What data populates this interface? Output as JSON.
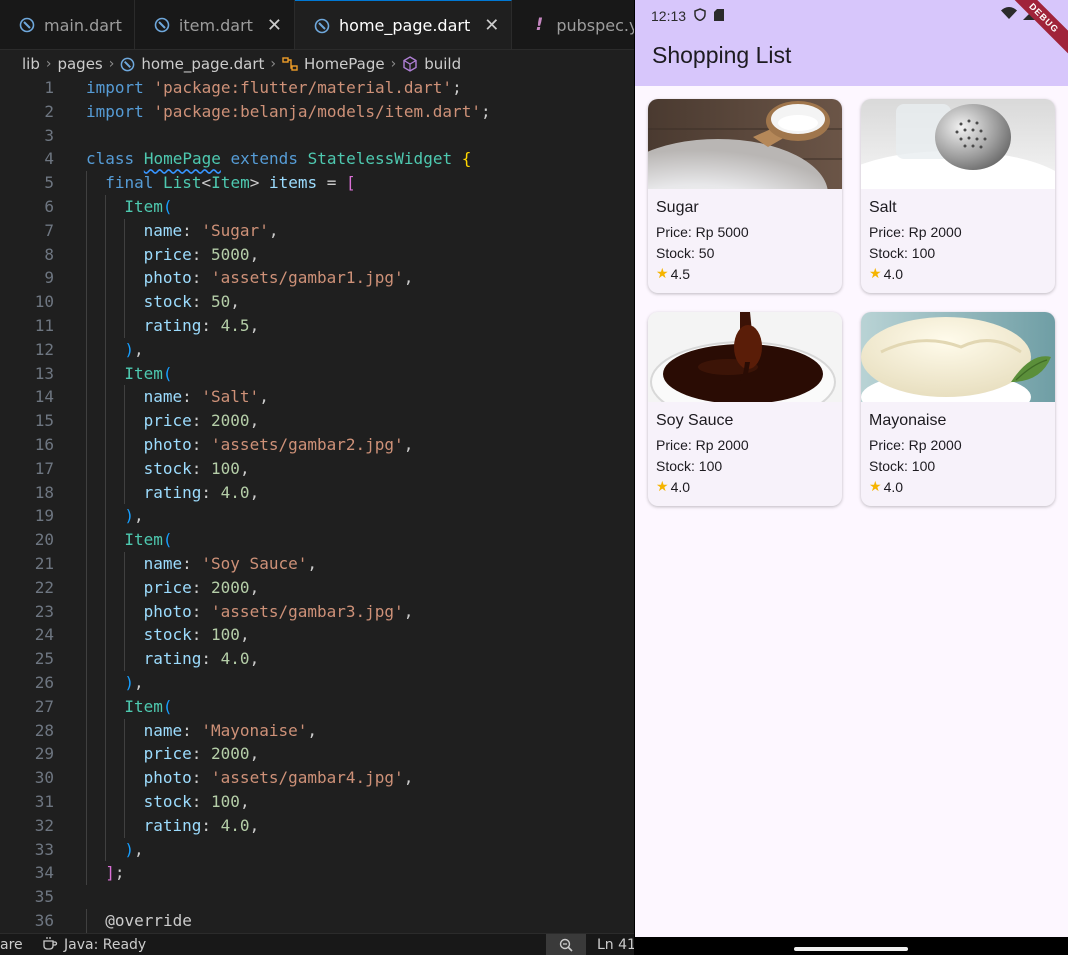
{
  "editor": {
    "tabs": [
      {
        "label": "main.dart",
        "icon": "dart-icon",
        "active": false,
        "closable": false
      },
      {
        "label": "item.dart",
        "icon": "dart-icon",
        "active": false,
        "closable": true
      },
      {
        "label": "home_page.dart",
        "icon": "dart-icon",
        "active": true,
        "closable": true
      },
      {
        "label": "pubspec.yaml",
        "icon": "warning-bang-icon",
        "active": false,
        "closable": false
      }
    ],
    "breadcrumb": [
      "lib",
      "pages",
      "home_page.dart",
      "HomePage",
      "build"
    ],
    "code_lines": [
      {
        "n": "1",
        "indent": 0,
        "tokens": [
          [
            "import",
            "kw"
          ],
          [
            " ",
            "plain"
          ],
          [
            "'package:flutter/material.dart'",
            "str"
          ],
          [
            ";",
            "plain"
          ]
        ]
      },
      {
        "n": "2",
        "indent": 0,
        "tokens": [
          [
            "import",
            "kw"
          ],
          [
            " ",
            "plain"
          ],
          [
            "'package:belanja/models/item.dart'",
            "str"
          ],
          [
            ";",
            "plain"
          ]
        ]
      },
      {
        "n": "3",
        "indent": 0,
        "tokens": []
      },
      {
        "n": "4",
        "indent": 0,
        "tokens": [
          [
            "class",
            "kw"
          ],
          [
            " ",
            "plain"
          ],
          [
            "HomePage",
            "cls squig"
          ],
          [
            " ",
            "plain"
          ],
          [
            "extends",
            "kw"
          ],
          [
            " ",
            "plain"
          ],
          [
            "StatelessWidget",
            "cls"
          ],
          [
            " ",
            "plain"
          ],
          [
            "{",
            "br1"
          ]
        ]
      },
      {
        "n": "5",
        "indent": 1,
        "tokens": [
          [
            "final",
            "kw"
          ],
          [
            " ",
            "plain"
          ],
          [
            "List",
            "cls"
          ],
          [
            "<",
            "plain"
          ],
          [
            "Item",
            "cls"
          ],
          [
            "> ",
            "plain"
          ],
          [
            "items",
            "prop"
          ],
          [
            " = ",
            "plain"
          ],
          [
            "[",
            "br2"
          ]
        ]
      },
      {
        "n": "6",
        "indent": 2,
        "tokens": [
          [
            "Item",
            "cls"
          ],
          [
            "(",
            "br3"
          ]
        ]
      },
      {
        "n": "7",
        "indent": 3,
        "tokens": [
          [
            "name",
            "prop"
          ],
          [
            ": ",
            "plain"
          ],
          [
            "'Sugar'",
            "str"
          ],
          [
            ",",
            "plain"
          ]
        ]
      },
      {
        "n": "8",
        "indent": 3,
        "tokens": [
          [
            "price",
            "prop"
          ],
          [
            ": ",
            "plain"
          ],
          [
            "5000",
            "num"
          ],
          [
            ",",
            "plain"
          ]
        ]
      },
      {
        "n": "9",
        "indent": 3,
        "tokens": [
          [
            "photo",
            "prop"
          ],
          [
            ": ",
            "plain"
          ],
          [
            "'assets/gambar1.jpg'",
            "str"
          ],
          [
            ",",
            "plain"
          ]
        ]
      },
      {
        "n": "10",
        "indent": 3,
        "tokens": [
          [
            "stock",
            "prop"
          ],
          [
            ": ",
            "plain"
          ],
          [
            "50",
            "num"
          ],
          [
            ",",
            "plain"
          ]
        ]
      },
      {
        "n": "11",
        "indent": 3,
        "tokens": [
          [
            "rating",
            "prop"
          ],
          [
            ": ",
            "plain"
          ],
          [
            "4.5",
            "num"
          ],
          [
            ",",
            "plain"
          ]
        ]
      },
      {
        "n": "12",
        "indent": 2,
        "tokens": [
          [
            ")",
            "br3"
          ],
          [
            ",",
            "plain"
          ]
        ]
      },
      {
        "n": "13",
        "indent": 2,
        "tokens": [
          [
            "Item",
            "cls"
          ],
          [
            "(",
            "br3"
          ]
        ]
      },
      {
        "n": "14",
        "indent": 3,
        "tokens": [
          [
            "name",
            "prop"
          ],
          [
            ": ",
            "plain"
          ],
          [
            "'Salt'",
            "str"
          ],
          [
            ",",
            "plain"
          ]
        ]
      },
      {
        "n": "15",
        "indent": 3,
        "tokens": [
          [
            "price",
            "prop"
          ],
          [
            ": ",
            "plain"
          ],
          [
            "2000",
            "num"
          ],
          [
            ",",
            "plain"
          ]
        ]
      },
      {
        "n": "16",
        "indent": 3,
        "tokens": [
          [
            "photo",
            "prop"
          ],
          [
            ": ",
            "plain"
          ],
          [
            "'assets/gambar2.jpg'",
            "str"
          ],
          [
            ",",
            "plain"
          ]
        ]
      },
      {
        "n": "17",
        "indent": 3,
        "tokens": [
          [
            "stock",
            "prop"
          ],
          [
            ": ",
            "plain"
          ],
          [
            "100",
            "num"
          ],
          [
            ",",
            "plain"
          ]
        ]
      },
      {
        "n": "18",
        "indent": 3,
        "tokens": [
          [
            "rating",
            "prop"
          ],
          [
            ": ",
            "plain"
          ],
          [
            "4.0",
            "num"
          ],
          [
            ",",
            "plain"
          ]
        ]
      },
      {
        "n": "19",
        "indent": 2,
        "tokens": [
          [
            ")",
            "br3"
          ],
          [
            ",",
            "plain"
          ]
        ]
      },
      {
        "n": "20",
        "indent": 2,
        "tokens": [
          [
            "Item",
            "cls"
          ],
          [
            "(",
            "br3"
          ]
        ]
      },
      {
        "n": "21",
        "indent": 3,
        "tokens": [
          [
            "name",
            "prop"
          ],
          [
            ": ",
            "plain"
          ],
          [
            "'Soy Sauce'",
            "str"
          ],
          [
            ",",
            "plain"
          ]
        ]
      },
      {
        "n": "22",
        "indent": 3,
        "tokens": [
          [
            "price",
            "prop"
          ],
          [
            ": ",
            "plain"
          ],
          [
            "2000",
            "num"
          ],
          [
            ",",
            "plain"
          ]
        ]
      },
      {
        "n": "23",
        "indent": 3,
        "tokens": [
          [
            "photo",
            "prop"
          ],
          [
            ": ",
            "plain"
          ],
          [
            "'assets/gambar3.jpg'",
            "str"
          ],
          [
            ",",
            "plain"
          ]
        ]
      },
      {
        "n": "24",
        "indent": 3,
        "tokens": [
          [
            "stock",
            "prop"
          ],
          [
            ": ",
            "plain"
          ],
          [
            "100",
            "num"
          ],
          [
            ",",
            "plain"
          ]
        ]
      },
      {
        "n": "25",
        "indent": 3,
        "tokens": [
          [
            "rating",
            "prop"
          ],
          [
            ": ",
            "plain"
          ],
          [
            "4.0",
            "num"
          ],
          [
            ",",
            "plain"
          ]
        ]
      },
      {
        "n": "26",
        "indent": 2,
        "tokens": [
          [
            ")",
            "br3"
          ],
          [
            ",",
            "plain"
          ]
        ]
      },
      {
        "n": "27",
        "indent": 2,
        "tokens": [
          [
            "Item",
            "cls"
          ],
          [
            "(",
            "br3"
          ]
        ]
      },
      {
        "n": "28",
        "indent": 3,
        "tokens": [
          [
            "name",
            "prop"
          ],
          [
            ": ",
            "plain"
          ],
          [
            "'Mayonaise'",
            "str"
          ],
          [
            ",",
            "plain"
          ]
        ]
      },
      {
        "n": "29",
        "indent": 3,
        "tokens": [
          [
            "price",
            "prop"
          ],
          [
            ": ",
            "plain"
          ],
          [
            "2000",
            "num"
          ],
          [
            ",",
            "plain"
          ]
        ]
      },
      {
        "n": "30",
        "indent": 3,
        "tokens": [
          [
            "photo",
            "prop"
          ],
          [
            ": ",
            "plain"
          ],
          [
            "'assets/gambar4.jpg'",
            "str"
          ],
          [
            ",",
            "plain"
          ]
        ]
      },
      {
        "n": "31",
        "indent": 3,
        "tokens": [
          [
            "stock",
            "prop"
          ],
          [
            ": ",
            "plain"
          ],
          [
            "100",
            "num"
          ],
          [
            ",",
            "plain"
          ]
        ]
      },
      {
        "n": "32",
        "indent": 3,
        "tokens": [
          [
            "rating",
            "prop"
          ],
          [
            ": ",
            "plain"
          ],
          [
            "4.0",
            "num"
          ],
          [
            ",",
            "plain"
          ]
        ]
      },
      {
        "n": "33",
        "indent": 2,
        "tokens": [
          [
            ")",
            "br3"
          ],
          [
            ",",
            "plain"
          ]
        ]
      },
      {
        "n": "34",
        "indent": 1,
        "tokens": [
          [
            "]",
            "br2"
          ],
          [
            ";",
            "plain"
          ]
        ]
      },
      {
        "n": "35",
        "indent": 0,
        "tokens": []
      },
      {
        "n": "36",
        "indent": 1,
        "tokens": [
          [
            "@override",
            "anno"
          ]
        ]
      }
    ],
    "status": {
      "left_fragment": "are",
      "java": "Java: Ready",
      "position": "Ln 41"
    }
  },
  "phone": {
    "time": "12:13",
    "debug_banner": "DEBUG",
    "app_title": "Shopping List",
    "items": [
      {
        "name": "Sugar",
        "price": "Price: Rp 5000",
        "stock": "Stock: 50",
        "rating": "4.5",
        "photo": "sugar"
      },
      {
        "name": "Salt",
        "price": "Price: Rp 2000",
        "stock": "Stock: 100",
        "rating": "4.0",
        "photo": "salt"
      },
      {
        "name": "Soy Sauce",
        "price": "Price: Rp 2000",
        "stock": "Stock: 100",
        "rating": "4.0",
        "photo": "soy-sauce"
      },
      {
        "name": "Mayonaise",
        "price": "Price: Rp 2000",
        "stock": "Stock: 100",
        "rating": "4.0",
        "photo": "mayonaise"
      }
    ]
  },
  "colors": {
    "appbar": "#d7c6fb",
    "screen_bg": "#fdf7ff",
    "card_bg": "#f7f2fa",
    "star": "#f5b400",
    "editor_bg": "#1f1f1f",
    "tab_active_border": "#0078d4"
  }
}
